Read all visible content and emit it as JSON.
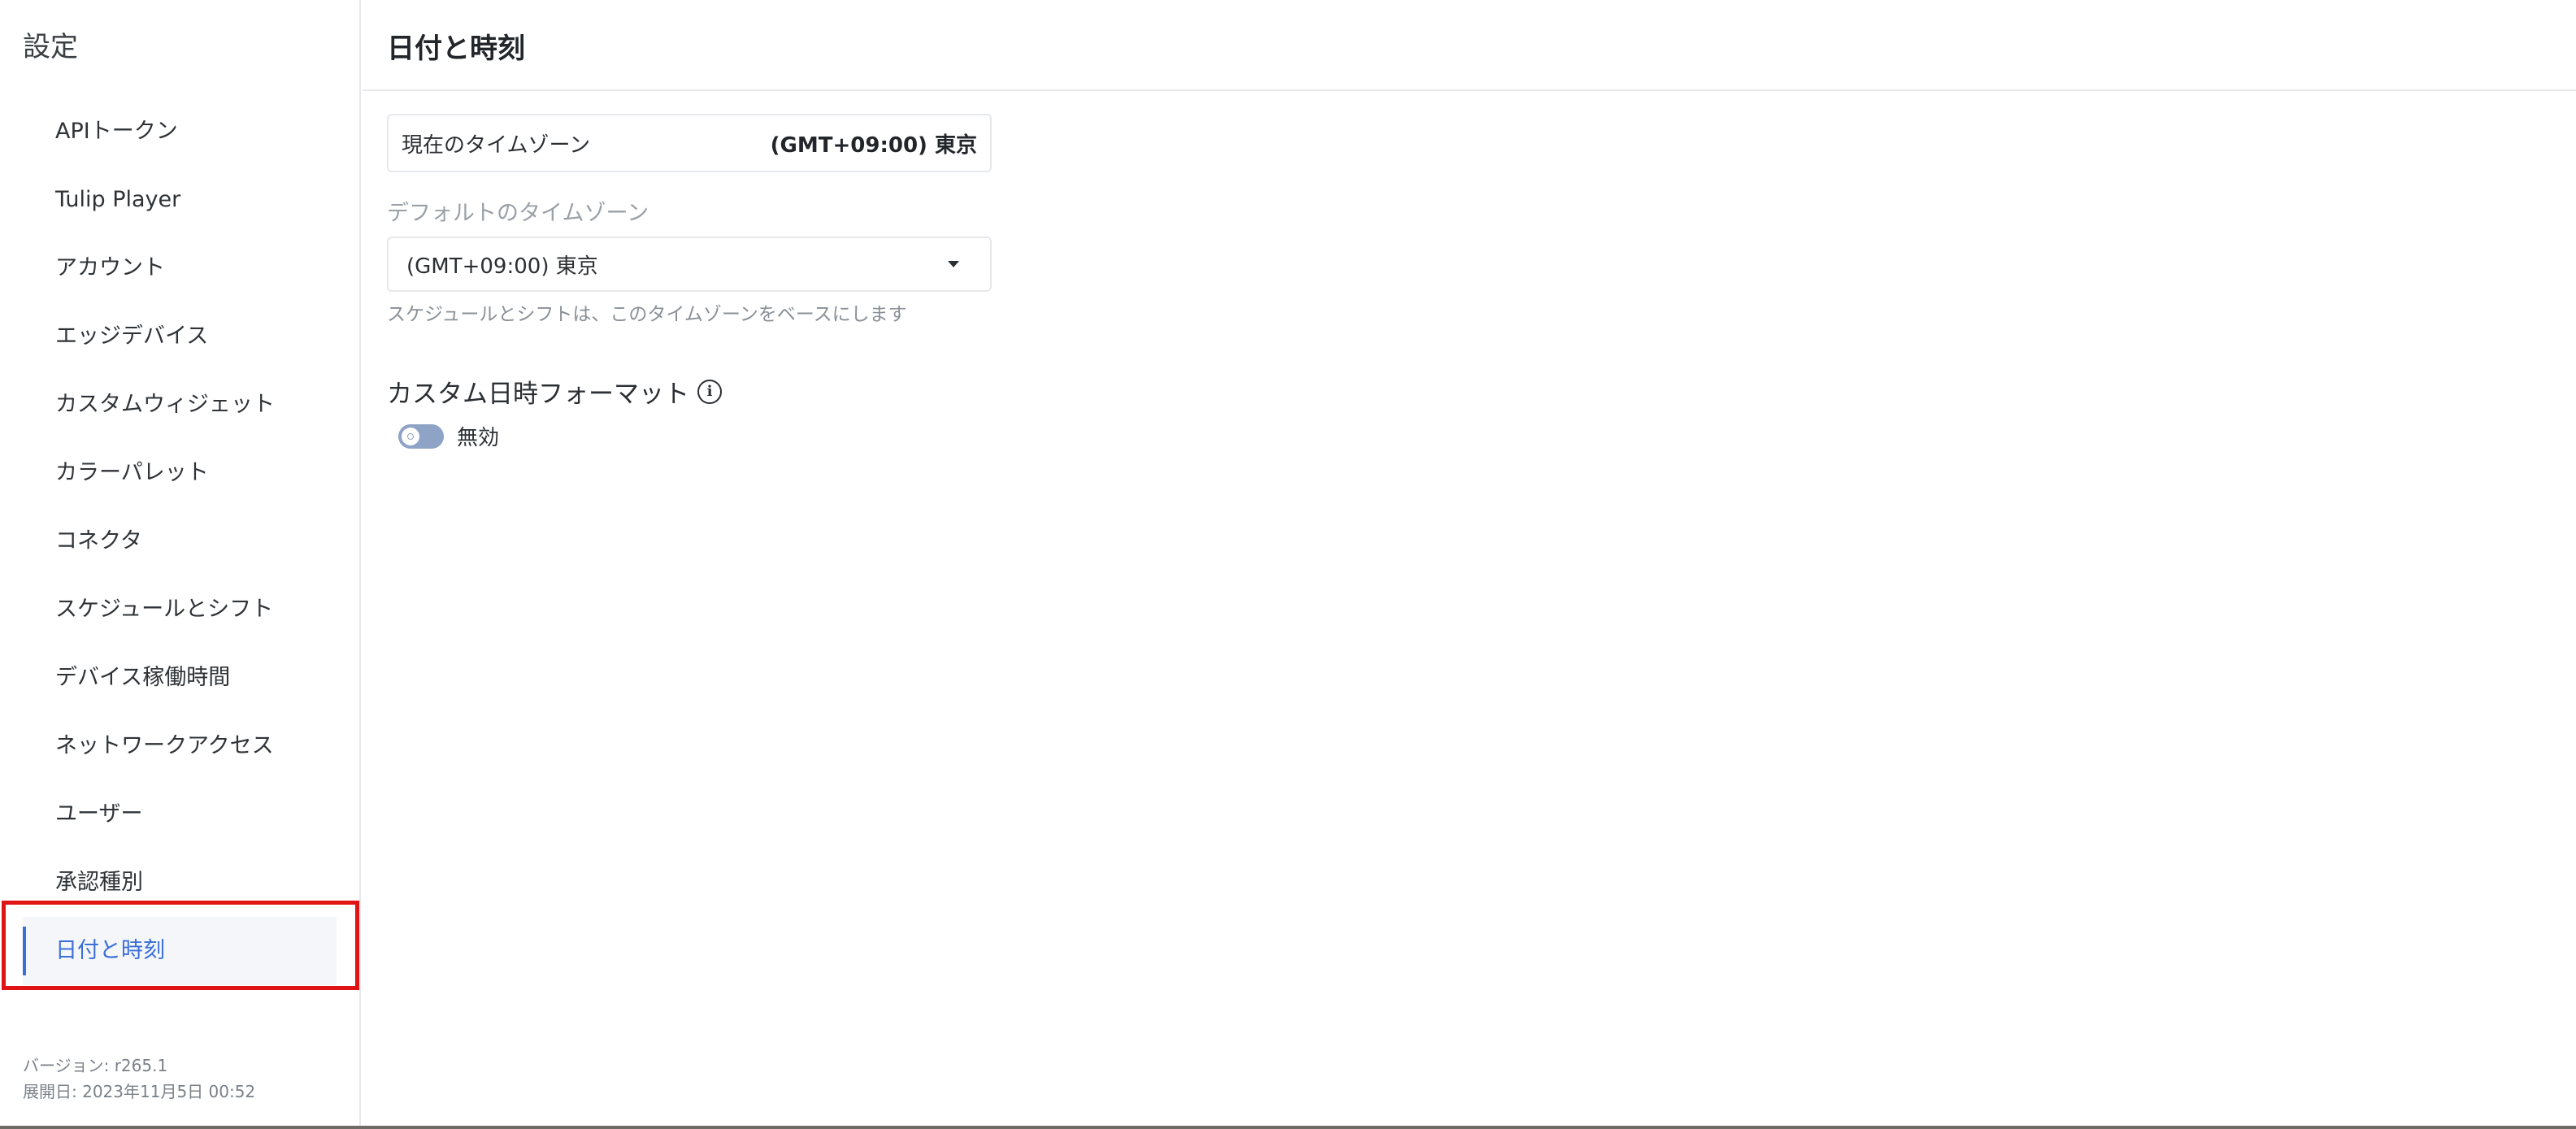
{
  "sidebar": {
    "title": "設定",
    "items": [
      {
        "label": "APIトークン"
      },
      {
        "label": "Tulip Player"
      },
      {
        "label": "アカウント"
      },
      {
        "label": "エッジデバイス"
      },
      {
        "label": "カスタムウィジェット"
      },
      {
        "label": "カラーパレット"
      },
      {
        "label": "コネクタ"
      },
      {
        "label": "スケジュールとシフト"
      },
      {
        "label": "デバイス稼働時間"
      },
      {
        "label": "ネットワークアクセス"
      },
      {
        "label": "ユーザー"
      },
      {
        "label": "承認種別"
      },
      {
        "label": "日付と時刻"
      }
    ],
    "active_index": 12,
    "version": "バージョン: r265.1",
    "deploy_date": "展開日: 2023年11月5日 00:52"
  },
  "main": {
    "title": "日付と時刻",
    "current_timezone": {
      "label": "現在のタイムゾーン",
      "value": "(GMT+09:00) 東京"
    },
    "default_timezone": {
      "label": "デフォルトのタイムゾーン",
      "selected": "(GMT+09:00) 東京",
      "help": "スケジュールとシフトは、このタイムゾーンをベースにします"
    },
    "custom_format": {
      "title": "カスタム日時フォーマット",
      "toggle_state": "無効"
    }
  },
  "colors": {
    "accent": "#3b6fd8",
    "highlight": "#e01414",
    "toggle_off": "#8fa3c7"
  }
}
